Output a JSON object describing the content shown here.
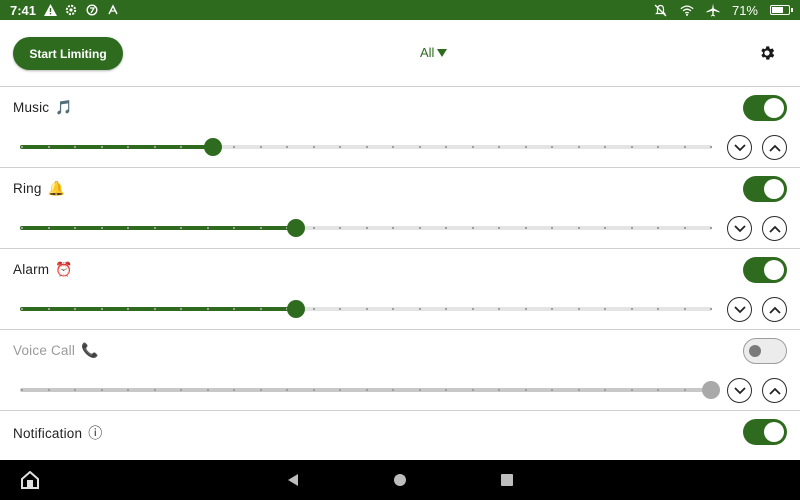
{
  "status_bar": {
    "time": "7:41",
    "battery_text": "71%",
    "battery_level": 0.71,
    "left_icons": [
      "warning-icon",
      "settings-gear-icon",
      "data-saver-icon",
      "signal-disabled-icon"
    ],
    "right_icons": [
      "notifications-off-icon",
      "wifi-icon",
      "airplane-mode-icon",
      "battery-icon"
    ]
  },
  "toolbar": {
    "start_label": "Start Limiting",
    "filter_label": "All",
    "settings_icon": "gear-icon"
  },
  "colors": {
    "accent": "#2e6b1f",
    "track": "#e4e4e4",
    "disabled": "#a9a9a9"
  },
  "streams": [
    {
      "label": "Music",
      "emoji": "🎵",
      "enabled": true,
      "level": 0.28
    },
    {
      "label": "Ring",
      "emoji": "🔔",
      "enabled": true,
      "level": 0.4
    },
    {
      "label": "Alarm",
      "emoji": "⏰",
      "enabled": true,
      "level": 0.4
    },
    {
      "label": "Voice Call",
      "emoji": "📞",
      "enabled": false,
      "level": 1.0
    },
    {
      "label": "Notification",
      "emoji": "ⓘ",
      "enabled": true,
      "level": null
    }
  ],
  "nav_bar": {
    "icons": [
      "home-app-icon",
      "back-icon",
      "home-icon",
      "recents-icon"
    ]
  }
}
